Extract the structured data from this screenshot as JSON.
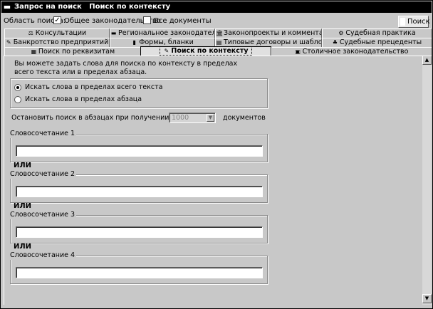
{
  "window": {
    "title": "Запрос на поиск   Поиск по контексту",
    "system_menu_icon": "window-menu-icon",
    "system_menu_glyph": "▬"
  },
  "scope": {
    "label": "Область поиска:",
    "general_law": {
      "label": "Общее законодательство",
      "checked": true,
      "mark": "✓"
    },
    "all_documents": {
      "label": "Все документы",
      "checked": false,
      "mark": ""
    },
    "search_button": "Поиск"
  },
  "tabs": {
    "row1": [
      {
        "label": "Консультации",
        "icon": "consult-icon",
        "glyph": "⚖"
      },
      {
        "label": "Региональное законодательство",
        "icon": "flag-icon",
        "glyph": "▬"
      },
      {
        "label": "Законопроекты и комментарии",
        "icon": "building-icon",
        "glyph": "🏛"
      },
      {
        "label": "Судебная практика",
        "icon": "court-icon",
        "glyph": "⚙"
      }
    ],
    "row2": [
      {
        "label": "Банкротство предприятий",
        "icon": "bankruptcy-icon",
        "glyph": "✎"
      },
      {
        "label": "Формы, бланки",
        "icon": "forms-icon",
        "glyph": "▮"
      },
      {
        "label": "Типовые договоры и шаблоны",
        "icon": "contracts-icon",
        "glyph": "▤"
      },
      {
        "label": "Судебные прецеденты",
        "icon": "precedent-icon",
        "glyph": "♣"
      }
    ],
    "row3": [
      {
        "label": "Поиск по реквизитам",
        "icon": "requisites-icon",
        "glyph": "▦"
      },
      {
        "label": "Поиск по контексту",
        "icon": "context-search-icon",
        "glyph": "✎",
        "active": true
      },
      {
        "label": "Столичное законодательство",
        "icon": "capital-icon",
        "glyph": "▣"
      }
    ]
  },
  "content": {
    "intro": "Вы можете задать слова для поиска по контексту в пределах всего текста или в пределах абзаца.",
    "radio_whole_text": "Искать слова в пределах всего текста",
    "radio_paragraph": "Искать слова в пределах абзаца",
    "stop_label": "Остановить поиск в абзацах при получении списка из",
    "limit_value": "1000",
    "limit_suffix": "документов",
    "phrase1_label": "Словосочетание 1",
    "phrase2_label": "Словосочетание 2",
    "phrase3_label": "Словосочетание 3",
    "phrase4_label": "Словосочетание 4",
    "or_label": "ИЛИ",
    "phrase1_value": "",
    "phrase2_value": "",
    "phrase3_value": "",
    "phrase4_value": ""
  },
  "scrollbar": {
    "up_glyph": "▲",
    "down_glyph": "▼"
  }
}
